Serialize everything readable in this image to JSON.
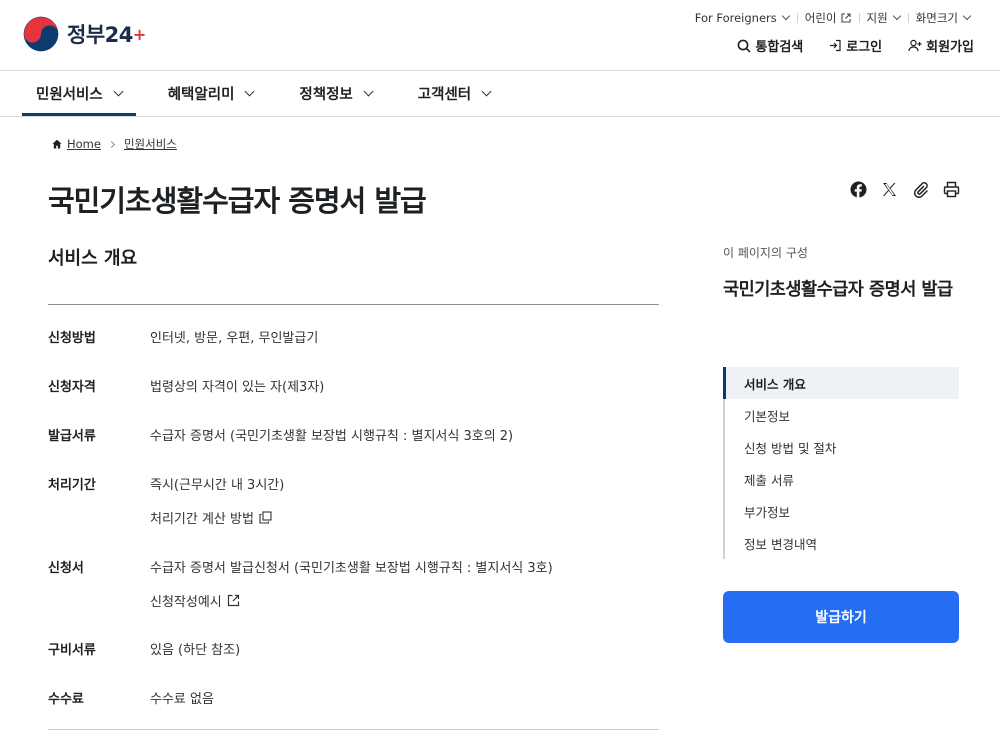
{
  "brand": {
    "name": "정부",
    "num": "24"
  },
  "utility": [
    {
      "label": "For Foreigners",
      "icon": "chevron-down-icon"
    },
    {
      "label": "어린이",
      "icon": "external-link-icon"
    },
    {
      "label": "지원",
      "icon": "chevron-down-icon"
    },
    {
      "label": "화면크기",
      "icon": "chevron-down-icon"
    }
  ],
  "actions": {
    "search": "통합검색",
    "login": "로그인",
    "signup": "회원가입"
  },
  "gnb": [
    "민원서비스",
    "혜택알리미",
    "정책정보",
    "고객센터"
  ],
  "breadcrumb": {
    "home": "Home",
    "current": "민원서비스"
  },
  "page": {
    "title": "국민기초생활수급자 증명서 발급"
  },
  "overview": {
    "title": "서비스 개요",
    "rows": [
      {
        "key": "신청방법",
        "value": "인터넷, 방문, 우편, 무인발급기"
      },
      {
        "key": "신청자격",
        "value": "법령상의 자격이 있는 자(제3자)"
      },
      {
        "key": "발급서류",
        "value": "수급자 증명서 (국민기초생활 보장법 시행규칙 : 별지서식 3호의 2)"
      },
      {
        "key": "처리기간",
        "value": "즉시(근무시간 내 3시간)",
        "link": "처리기간 계산 방법"
      },
      {
        "key": "신청서",
        "value": "수급자 증명서 발급신청서 (국민기초생활 보장법 시행규칙 : 별지서식 3호)",
        "link": "신청작성예시"
      },
      {
        "key": "구비서류",
        "value": "있음 (하단 참조)"
      },
      {
        "key": "수수료",
        "value": "수수료 없음"
      }
    ]
  },
  "toc": {
    "caption": "이 페이지의 구성",
    "title": "국민기초생활수급자 증명서 발급",
    "items": [
      "서비스 개요",
      "기본정보",
      "신청 방법 및 절차",
      "제출 서류",
      "부가정보",
      "정보 변경내역"
    ]
  },
  "cta": {
    "label": "발급하기"
  },
  "colors": {
    "primary": "#256ef4",
    "navy": "#0b3b6f",
    "accent_red": "#e6343f"
  }
}
